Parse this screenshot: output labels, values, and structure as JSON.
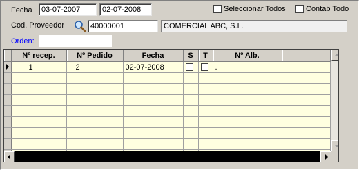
{
  "filters": {
    "fecha_label": "Fecha",
    "fecha_desde": "03-07-2007",
    "fecha_hasta": "02-07-2008",
    "seleccionar_todos_label": "Seleccionar Todos",
    "contab_todo_label": "Contab Todo",
    "cod_proveedor_label": "Cod. Proveedor",
    "cod_proveedor_value": "40000001",
    "proveedor_nombre": "COMERCIAL ABC, S.L.",
    "orden_label": "Orden:",
    "orden_value": ""
  },
  "grid": {
    "columns": [
      "Nº recep.",
      "Nº Pedido",
      "Fecha",
      "S",
      "T",
      "Nº Alb."
    ],
    "rows": [
      {
        "recep": "1",
        "pedido": "2",
        "fecha": "02-07-2008",
        "s": false,
        "t": false,
        "alb": "."
      }
    ],
    "empty_rows": 8
  },
  "colors": {
    "window_bg": "#d4d0c8",
    "grid_bg": "#ffffe0",
    "orden_label_color": "#0000ff"
  },
  "icons": {
    "search": "magnifier"
  }
}
